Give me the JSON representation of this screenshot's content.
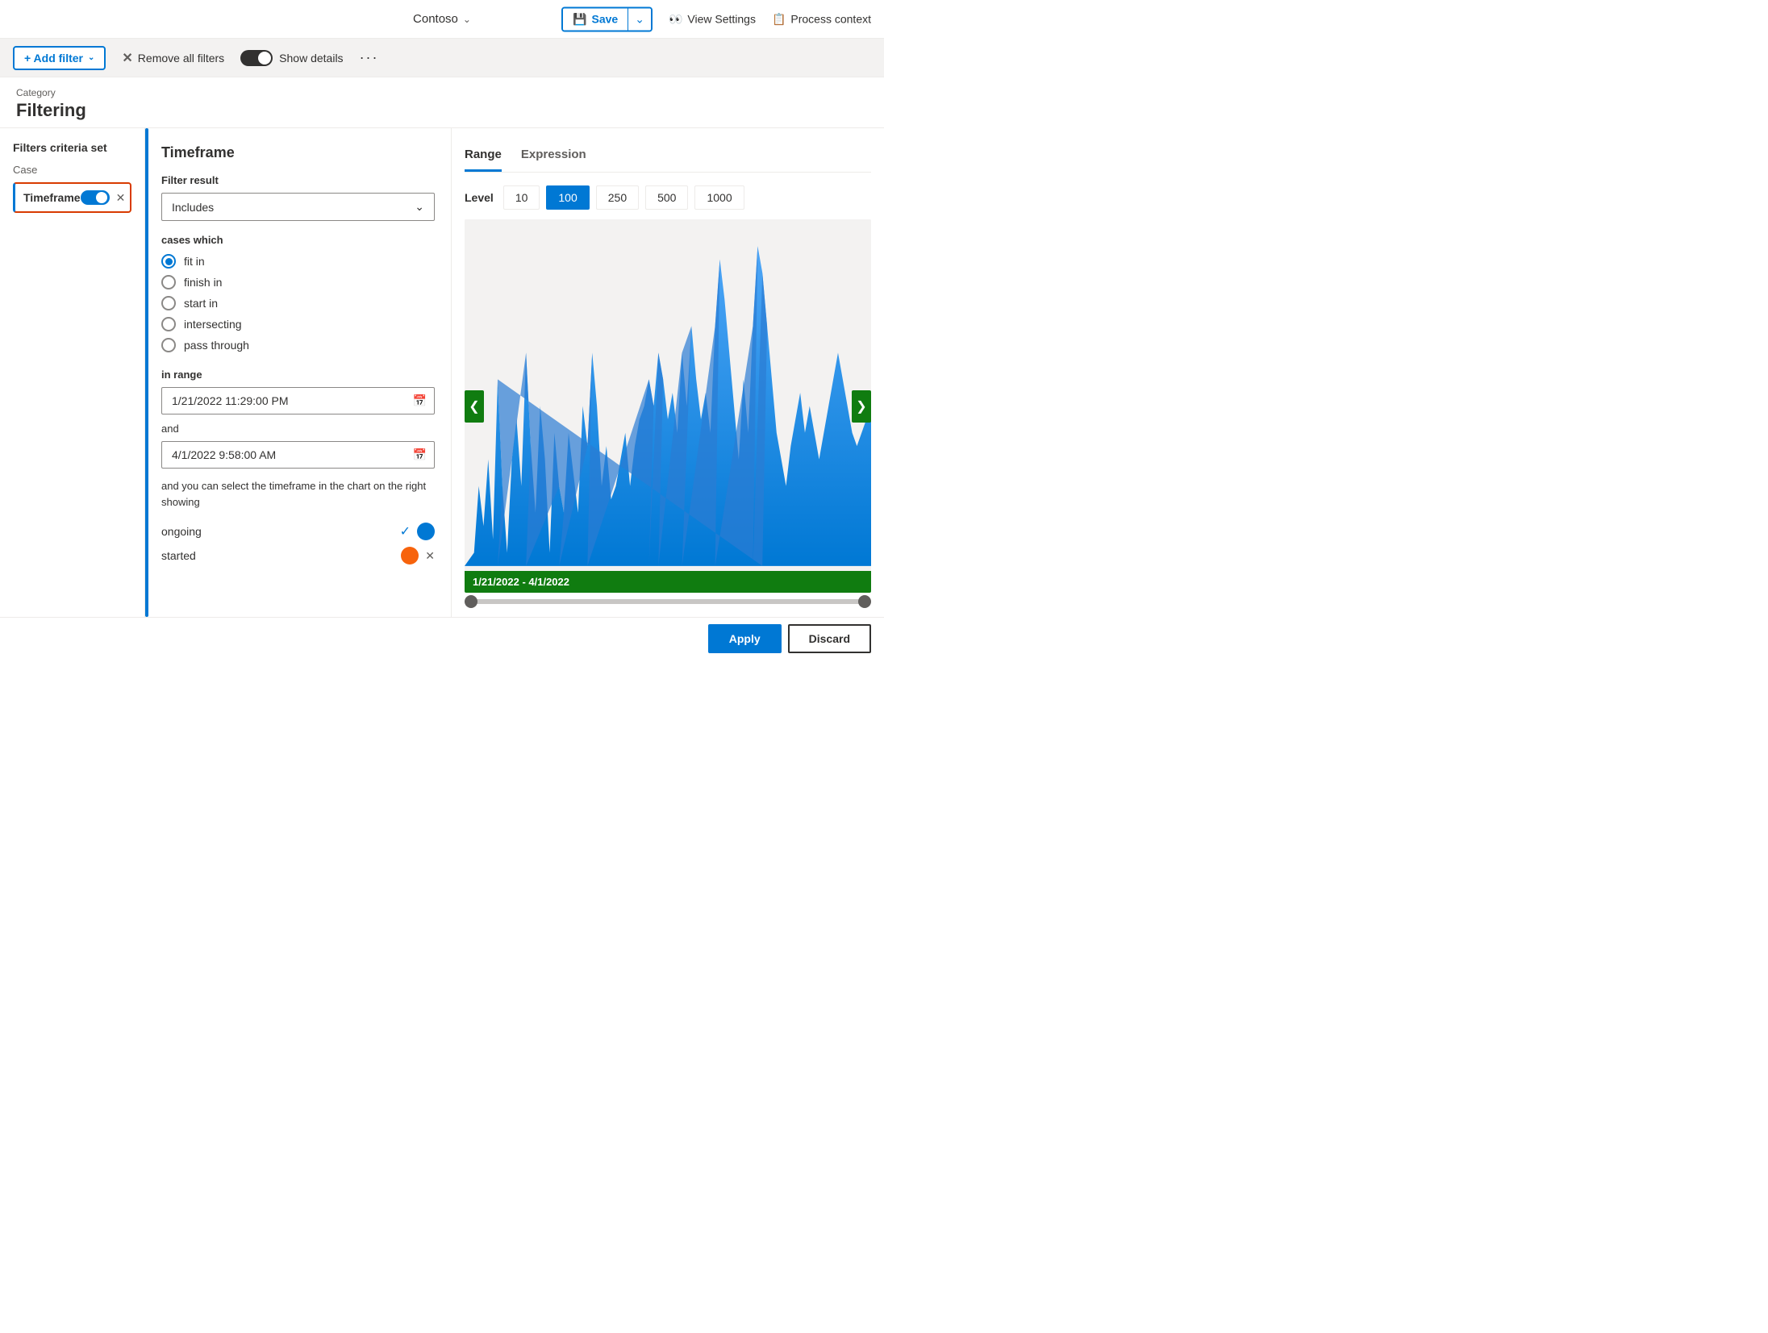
{
  "topnav": {
    "company": "Contoso",
    "save_label": "Save",
    "view_settings_label": "View Settings",
    "process_context_label": "Process context"
  },
  "toolbar": {
    "add_filter_label": "+ Add filter",
    "remove_all_label": "Remove all filters",
    "show_details_label": "Show details",
    "dots": "···"
  },
  "page_header": {
    "category_label": "Category",
    "page_title": "Filtering"
  },
  "left_panel": {
    "section_title": "Filters criteria set",
    "case_label": "Case",
    "filter_item": "Timeframe"
  },
  "middle_panel": {
    "title": "Timeframe",
    "filter_result_label": "Filter result",
    "filter_result_value": "Includes",
    "cases_which_label": "cases which",
    "radio_options": [
      {
        "id": "fit_in",
        "label": "fit in",
        "selected": true
      },
      {
        "id": "finish_in",
        "label": "finish in",
        "selected": false
      },
      {
        "id": "start_in",
        "label": "start in",
        "selected": false
      },
      {
        "id": "intersecting",
        "label": "intersecting",
        "selected": false
      },
      {
        "id": "pass_through",
        "label": "pass through",
        "selected": false
      }
    ],
    "in_range_label": "in range",
    "start_date": "1/21/2022 11:29:00 PM",
    "end_date": "4/1/2022 9:58:00 AM",
    "and_label": "and",
    "description": "and you can select the timeframe in the chart on the right showing",
    "ongoing_label": "ongoing",
    "started_label": "started"
  },
  "right_panel": {
    "tab_range_label": "Range",
    "tab_expression_label": "Expression",
    "level_label": "Level",
    "level_options": [
      {
        "value": "10",
        "active": false
      },
      {
        "value": "100",
        "active": true
      },
      {
        "value": "250",
        "active": false
      },
      {
        "value": "500",
        "active": false
      },
      {
        "value": "1000",
        "active": false
      }
    ],
    "chart_date_range": "1/21/2022 - 4/1/2022"
  },
  "bottom_bar": {
    "apply_label": "Apply",
    "discard_label": "Discard"
  }
}
